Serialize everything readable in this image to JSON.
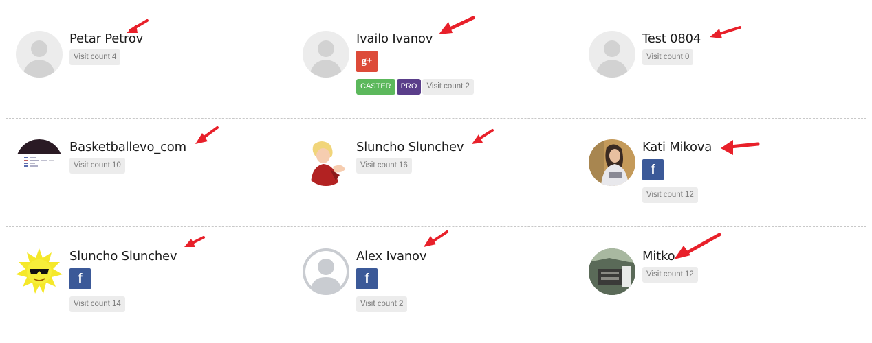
{
  "users": [
    {
      "name": "Petar Petrov",
      "visit_label": "Visit count 4",
      "avatar": "default-avatar-icon"
    },
    {
      "name": "Ivailo Ivanov",
      "visit_label": "Visit count 2",
      "social": "google-plus-icon",
      "social_glyph": "g+",
      "tags": [
        "CASTER",
        "PRO"
      ],
      "avatar": "default-avatar-icon"
    },
    {
      "name": "Test 0804",
      "visit_label": "Visit count 0",
      "avatar": "default-avatar-icon"
    },
    {
      "name": "Basketballevo_com",
      "visit_label": "Visit count 10",
      "avatar": "site-screenshot-avatar"
    },
    {
      "name": "Sluncho Slunchev",
      "visit_label": "Visit count 16",
      "avatar": "cartoon-woman-avatar"
    },
    {
      "name": "Kati Mikova",
      "visit_label": "Visit count 12",
      "social": "facebook-icon",
      "social_glyph": "f",
      "avatar": "photo-avatar"
    },
    {
      "name": "Sluncho Slunchev",
      "visit_label": "Visit count 14",
      "social": "facebook-icon",
      "social_glyph": "f",
      "avatar": "sun-sunglasses-avatar"
    },
    {
      "name": "Alex Ivanov",
      "visit_label": "Visit count 2",
      "social": "facebook-icon",
      "social_glyph": "f",
      "avatar": "facebook-default-avatar"
    },
    {
      "name": "Mitko",
      "visit_label": "Visit count 12",
      "avatar": "photo-avatar"
    }
  ],
  "colors": {
    "arrow": "#e8202a",
    "facebook": "#3b5998",
    "google_plus": "#dd4b39",
    "caster": "#5cb85c",
    "pro": "#5a3e8a"
  }
}
